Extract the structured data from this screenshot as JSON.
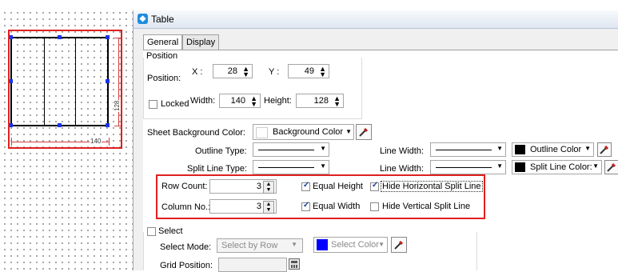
{
  "window": {
    "title": "Table"
  },
  "tabs": [
    {
      "label": "General"
    },
    {
      "label": "Display"
    }
  ],
  "position": {
    "group_label": "Position",
    "position_label": "Position:",
    "x_label": "X :",
    "x_value": "28",
    "y_label": "Y :",
    "y_value": "49",
    "locked_label": "Locked",
    "width_label": "Width:",
    "width_value": "140",
    "height_label": "Height:",
    "height_value": "128"
  },
  "preview": {
    "width_dim": "140",
    "height_dim": "128"
  },
  "background": {
    "label": "Sheet Background Color:",
    "color_button": "Background Color"
  },
  "outline": {
    "type_label": "Outline Type:",
    "width_label": "Line Width:",
    "color_button": "Outline Color",
    "color": "#000000"
  },
  "split": {
    "type_label": "Split Line Type:",
    "width_label": "Line Width:",
    "color_button": "Split Line Color:",
    "color": "#000000"
  },
  "rows": {
    "label": "Row Count:",
    "value": "3",
    "equal_height_label": "Equal Height",
    "equal_height_checked": true,
    "hide_horizontal_label": "Hide Horizontal Split Line",
    "hide_horizontal_checked": true
  },
  "columns": {
    "label": "Column No.:",
    "value": "3",
    "equal_width_label": "Equal Width",
    "equal_width_checked": true,
    "hide_vertical_label": "Hide Vertical Split Line",
    "hide_vertical_checked": false
  },
  "select": {
    "group_label": "Select",
    "mode_label": "Select Mode:",
    "mode_value": "Select by Row",
    "color_button": "Select Color",
    "color": "#0000ff",
    "grid_position_label": "Grid Position:"
  }
}
